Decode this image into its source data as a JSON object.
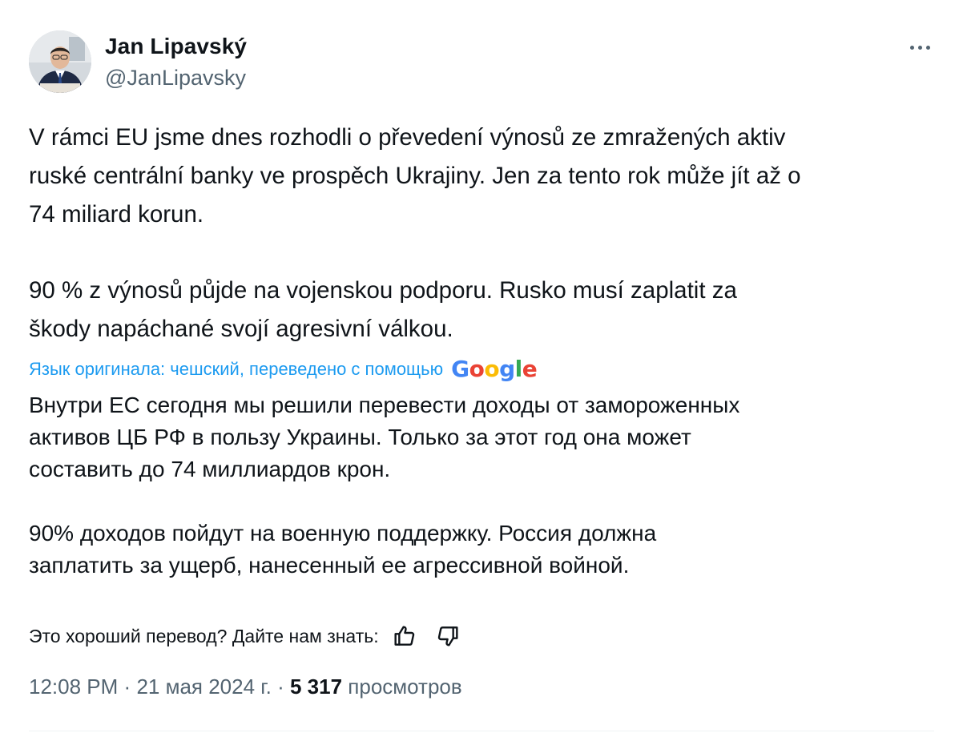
{
  "author": {
    "name": "Jan Lipavský",
    "handle": "@JanLipavsky"
  },
  "tweet": {
    "paragraphs": [
      "V rámci EU jsme dnes rozhodli o převedení výnosů ze zmražených aktiv\nruské centrální banky ve prospěch Ukrajiny. Jen za tento rok může jít až o\n74 miliard korun.",
      "90 % z výnosů půjde na vojenskou podporu. Rusko musí zaplatit za\nškody napáchané svojí agresivní válkou."
    ]
  },
  "translation": {
    "note": "Язык оригинала: чешский, переведено с помощью",
    "provider": "Google",
    "paragraphs": [
      "Внутри ЕС сегодня мы решили перевести доходы от замороженных\nактивов ЦБ РФ в пользу Украины. Только за этот год она может\nсоставить до 74 миллиардов крон.",
      "90% доходов пойдут на военную поддержку. Россия должна\nзаплатить за ущерб, нанесенный ее агрессивной войной."
    ],
    "feedback_prompt": "Это хороший перевод? Дайте нам знать:"
  },
  "meta": {
    "time": "12:08 PM",
    "separator": "·",
    "date": "21 мая 2024 г.",
    "views_count": "5 317",
    "views_label": "просмотров"
  },
  "icons": {
    "more": "more-horizontal-icon",
    "thumbs_up": "thumbs-up-icon",
    "thumbs_down": "thumbs-down-icon"
  },
  "colors": {
    "text": "#0f1419",
    "secondary": "#536471",
    "link": "#1d9bf0"
  }
}
